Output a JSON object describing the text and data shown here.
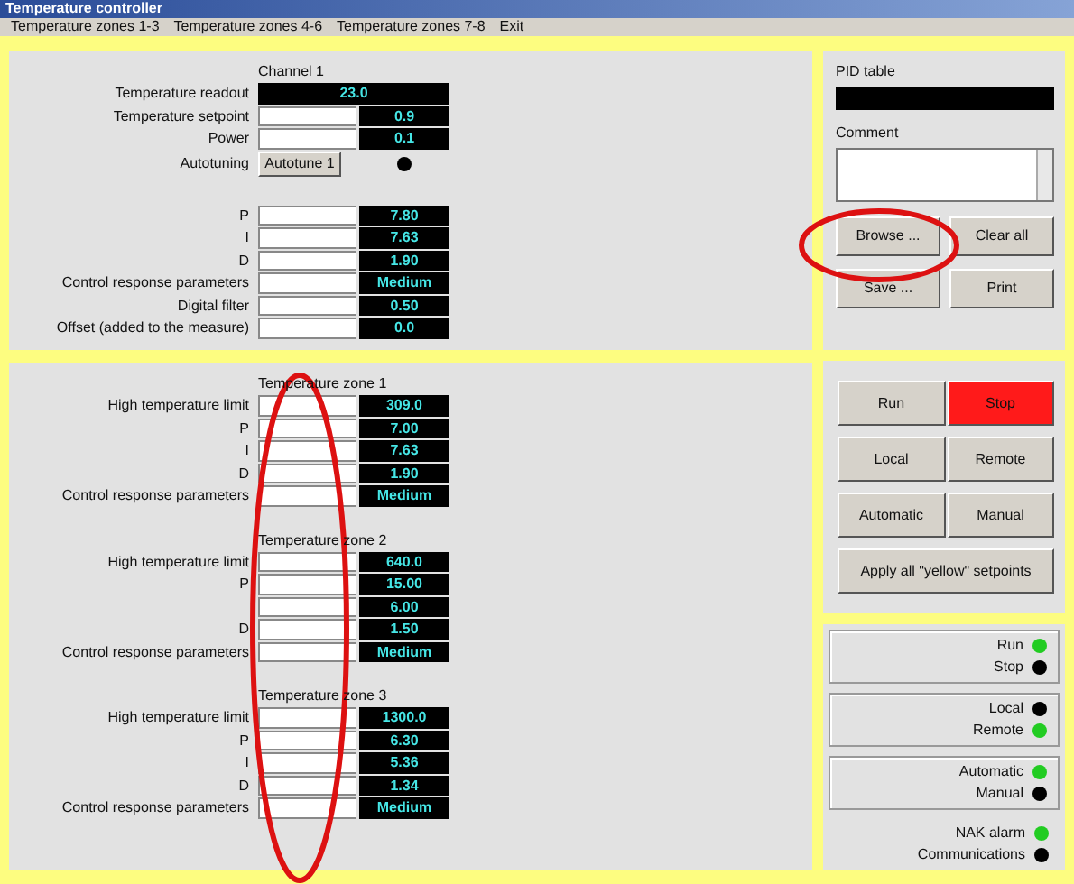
{
  "window": {
    "title": "Temperature controller"
  },
  "menu": [
    "Temperature zones 1-3",
    "Temperature zones 4-6",
    "Temperature zones 7-8",
    "Exit"
  ],
  "channel": {
    "title": "Channel 1",
    "rows": [
      {
        "kind": "readout",
        "label": "Temperature readout",
        "value": "23.0"
      },
      {
        "kind": "setpoint",
        "label": "Temperature setpoint",
        "value": "0.9"
      },
      {
        "kind": "setpoint",
        "label": "Power",
        "value": "0.1"
      },
      {
        "kind": "action",
        "label": "Autotuning",
        "button": "Autotune 1",
        "color": "#000000"
      }
    ],
    "pid_rows": [
      {
        "label": "P",
        "value": "7.80"
      },
      {
        "label": "I",
        "value": "7.63"
      },
      {
        "label": "D",
        "value": "1.90"
      },
      {
        "label": "Control response parameters",
        "value": "Medium"
      },
      {
        "label": "Digital filter",
        "value": "0.50"
      },
      {
        "label": "Offset (added to the measure)",
        "value": "0.0"
      }
    ]
  },
  "zones": [
    {
      "title": "Temperature zone 1",
      "rows": [
        {
          "label": "High temperature limit",
          "value": "309.0"
        },
        {
          "label": "P",
          "value": "7.00"
        },
        {
          "label": "I",
          "value": "7.63"
        },
        {
          "label": "D",
          "value": "1.90"
        },
        {
          "label": "Control response parameters",
          "value": "Medium"
        }
      ]
    },
    {
      "title": "Temperature zone 2",
      "rows": [
        {
          "label": "High temperature limit",
          "value": "640.0"
        },
        {
          "label": "P",
          "value": "15.00"
        },
        {
          "value": "6.00"
        },
        {
          "label": "D",
          "value": "1.50"
        },
        {
          "label": "Control response parameters",
          "value": "Medium"
        }
      ]
    },
    {
      "title": "Temperature zone 3",
      "rows": [
        {
          "label": "High temperature limit",
          "value": "1300.0"
        },
        {
          "label": "P",
          "value": "6.30"
        },
        {
          "label": "I",
          "value": "5.36"
        },
        {
          "label": "D",
          "value": "1.34"
        },
        {
          "label": "Control response parameters",
          "value": "Medium"
        }
      ]
    }
  ],
  "pid_table": {
    "label": "PID table",
    "comment_label": "Comment",
    "buttons": [
      "Browse ...",
      "Clear all",
      "Save ...",
      "Print"
    ]
  },
  "controls": [
    [
      {
        "label": "Run",
        "selected": false
      },
      {
        "label": "Stop",
        "selected": true
      }
    ],
    [
      {
        "label": "Local",
        "selected": false
      },
      {
        "label": "Remote",
        "selected": false
      }
    ],
    [
      {
        "label": "Automatic",
        "selected": false
      },
      {
        "label": "Manual",
        "selected": false
      }
    ],
    [
      {
        "label": "Apply all \"yellow\" setpoints",
        "selected": false
      }
    ]
  ],
  "status_groups": [
    {
      "boxed": true,
      "lamps": [
        {
          "label": "Run",
          "color": "#22cc22"
        },
        {
          "label": "Stop",
          "color": "#000000"
        }
      ]
    },
    {
      "boxed": true,
      "lamps": [
        {
          "label": "Local",
          "color": "#000000"
        },
        {
          "label": "Remote",
          "color": "#22cc22"
        }
      ]
    },
    {
      "boxed": true,
      "lamps": [
        {
          "label": "Automatic",
          "color": "#22cc22"
        },
        {
          "label": "Manual",
          "color": "#000000"
        }
      ]
    },
    {
      "boxed": false,
      "lamps": [
        {
          "label": "NAK alarm",
          "color": "#22cc22"
        },
        {
          "label": "Communications",
          "color": "#000000"
        }
      ]
    }
  ]
}
